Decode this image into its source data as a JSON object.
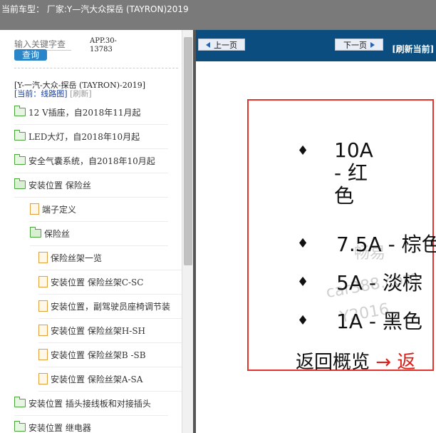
{
  "topbar": {
    "vehicle": "当前车型：  厂家:Y—汽大众探岳 (TAYRON)2019"
  },
  "sidebar": {
    "search_placeholder": "输入关键字查",
    "search_button": "查询",
    "app_code_line1": "APP.30-",
    "app_code_line2": "13783",
    "model": "[Y-一汽-大众-探岳 (TAYRON)-2019]",
    "current_label": "[当前：线路图]",
    "refresh_label": "[刷新]",
    "items": [
      {
        "label": "12 V插座，自2018年11月起"
      },
      {
        "label": "LED大灯，自2018年10月起"
      },
      {
        "label": "安全气囊系统，自2018年10月起"
      },
      {
        "label": "安装位置 保险丝"
      },
      {
        "label": "端子定义"
      },
      {
        "label": "保险丝"
      },
      {
        "label": "保险丝架一览"
      },
      {
        "label": "安装位置 保险丝架C-SC"
      },
      {
        "label": "安装位置，副驾驶员座椅调节装"
      },
      {
        "label": "安装位置 保险丝架H-SH"
      },
      {
        "label": "安装位置 保险丝架B -SB"
      },
      {
        "label": "安装位置 保险丝架A-SA"
      },
      {
        "label": "安装位置 插头接线板和对接插头"
      },
      {
        "label": "安装位置 继电器"
      }
    ]
  },
  "viewer": {
    "prev_label": "上一页",
    "next_label": "下一页",
    "refresh_current": "[刷新当前]",
    "slide": {
      "bullets": [
        {
          "line1": "10A",
          "line2": "- 红",
          "line3": "色"
        },
        {
          "text": "7.5A - 棕色"
        },
        {
          "text": "5A - 淡棕"
        },
        {
          "text": "1A - 黑色"
        }
      ],
      "watermarks": [
        "畅易",
        "car388.com",
        "Y2016"
      ],
      "back_text": "返回概览",
      "back_arrow": "→ 返"
    }
  },
  "colors": {
    "topbar": "#7a7a7a",
    "navbar": "#0a4d7e",
    "slide_border": "#e0342c",
    "search_button": "#2a86c9"
  }
}
